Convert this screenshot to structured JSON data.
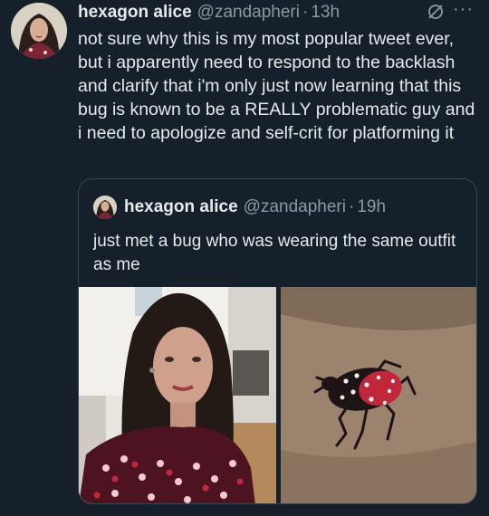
{
  "tweet": {
    "author_name": "hexagon alice",
    "author_handle": "@zandapheri",
    "separator": "·",
    "time": "13h",
    "text": "not sure why this is my most popular tweet ever, but i apparently need to respond to the backlash and clarify that i'm only just now learning that this bug is known to be a REALLY problematic guy and i need to apologize and self-crit for platforming it",
    "grok_icon": "grok-icon",
    "more_icon": "more-horizontal-icon",
    "more_glyph": "···"
  },
  "quoted_tweet": {
    "author_name": "hexagon alice",
    "author_handle": "@zandapheri",
    "separator": "·",
    "time": "19h",
    "text": "just met a bug who was wearing the same outfit as me",
    "images": [
      "selfie-photo",
      "spotted-lanternfly-photo"
    ]
  },
  "colors": {
    "background": "#15202b",
    "text": "#e7e9ea",
    "secondary_text": "#8b98a5",
    "border": "#38444d"
  }
}
